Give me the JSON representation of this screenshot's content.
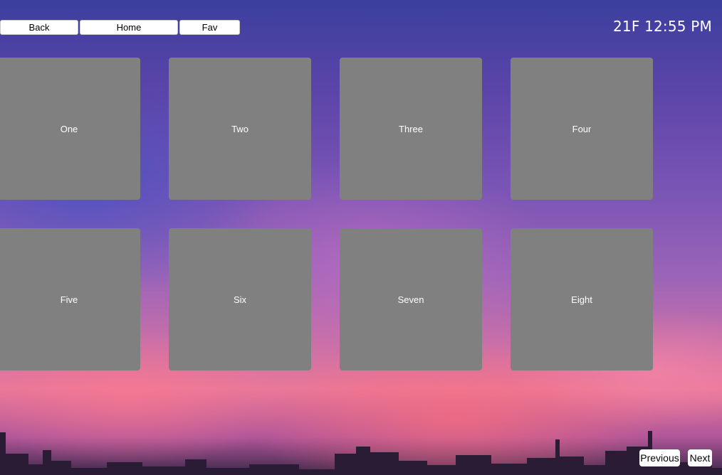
{
  "topbar": {
    "back_label": "Back",
    "home_label": "Home",
    "fav_label": "Fav"
  },
  "status": {
    "clock_text": "21F 12:55 PM"
  },
  "tiles": [
    {
      "label": "One"
    },
    {
      "label": "Two"
    },
    {
      "label": "Three"
    },
    {
      "label": "Four"
    },
    {
      "label": "Five"
    },
    {
      "label": "Six"
    },
    {
      "label": "Seven"
    },
    {
      "label": "Eight"
    }
  ],
  "pagination": {
    "previous_label": "Previous",
    "next_label": "Next"
  },
  "colors": {
    "tile_background": "#808080",
    "tile_text": "#ffffff",
    "button_background": "#ffffff"
  }
}
